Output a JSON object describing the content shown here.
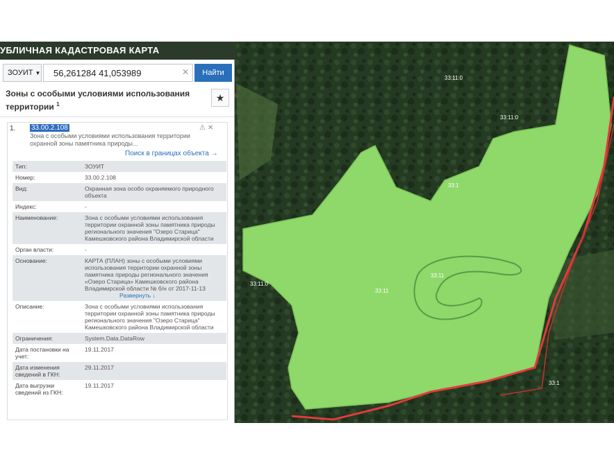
{
  "header": {
    "title": "УБЛИЧНАЯ КАДАСТРОВАЯ КАРТА"
  },
  "search": {
    "type_label": "ЗОУИТ",
    "coords_value": "56,261284 41,053989",
    "find_label": "Найти"
  },
  "section": {
    "title": "Зоны с особыми условиями использования территории",
    "count": "1"
  },
  "item": {
    "number": "1.",
    "id": "33.00.2.108",
    "description": "Зона с особыми условиями использования территории охранной зоны памятника природы...",
    "search_link": "Поиск в границах объекта →"
  },
  "attributes": [
    {
      "label": "Тип:",
      "value": "ЗОУИТ"
    },
    {
      "label": "Номер:",
      "value": "33.00.2.108"
    },
    {
      "label": "Вид:",
      "value": "Охранная зона особо охраняемого природного объекта"
    },
    {
      "label": "Индекс:",
      "value": "-"
    },
    {
      "label": "Наименование:",
      "value": "Зона с особыми условиями использования территории охранной зоны памятника природы регионального значения \"Озеро Старица\" Камешковского района Владимирской области"
    },
    {
      "label": "Орган власти:",
      "value": "-"
    },
    {
      "label": "Основание:",
      "value": "КАРТА (ПЛАН) зоны с особыми условиями использования территории охранной зоны памятника природы регионального значения «Озеро Старица» Камешковского района Владимирской области № б/н от 2017-11-13"
    },
    {
      "label": "Описание:",
      "value": "Зона с особыми условиями использования территории охранной зоны памятника природы регионального значения \"Озеро Старица\" Камешковского района Владимирской области"
    },
    {
      "label": "Ограничения:",
      "value": "System.Data.DataRow"
    },
    {
      "label": "Дата постановки на учет:",
      "value": "19.11.2017"
    },
    {
      "label": "Дата изменения сведений в ГКН:",
      "value": "29.11.2017"
    },
    {
      "label": "Дата выгрузки сведений из ГКН:",
      "value": "19.11.2017"
    }
  ],
  "expand_label": "Развернуть ↓",
  "map": {
    "zone_color": "#8fd86a",
    "forest_color": "#253a22",
    "border_color": "#e23b3b",
    "labels": [
      "33:11:0",
      "33:11:0",
      "33:1",
      "33:11",
      "33:11",
      "33:11:0",
      "33:1"
    ]
  }
}
